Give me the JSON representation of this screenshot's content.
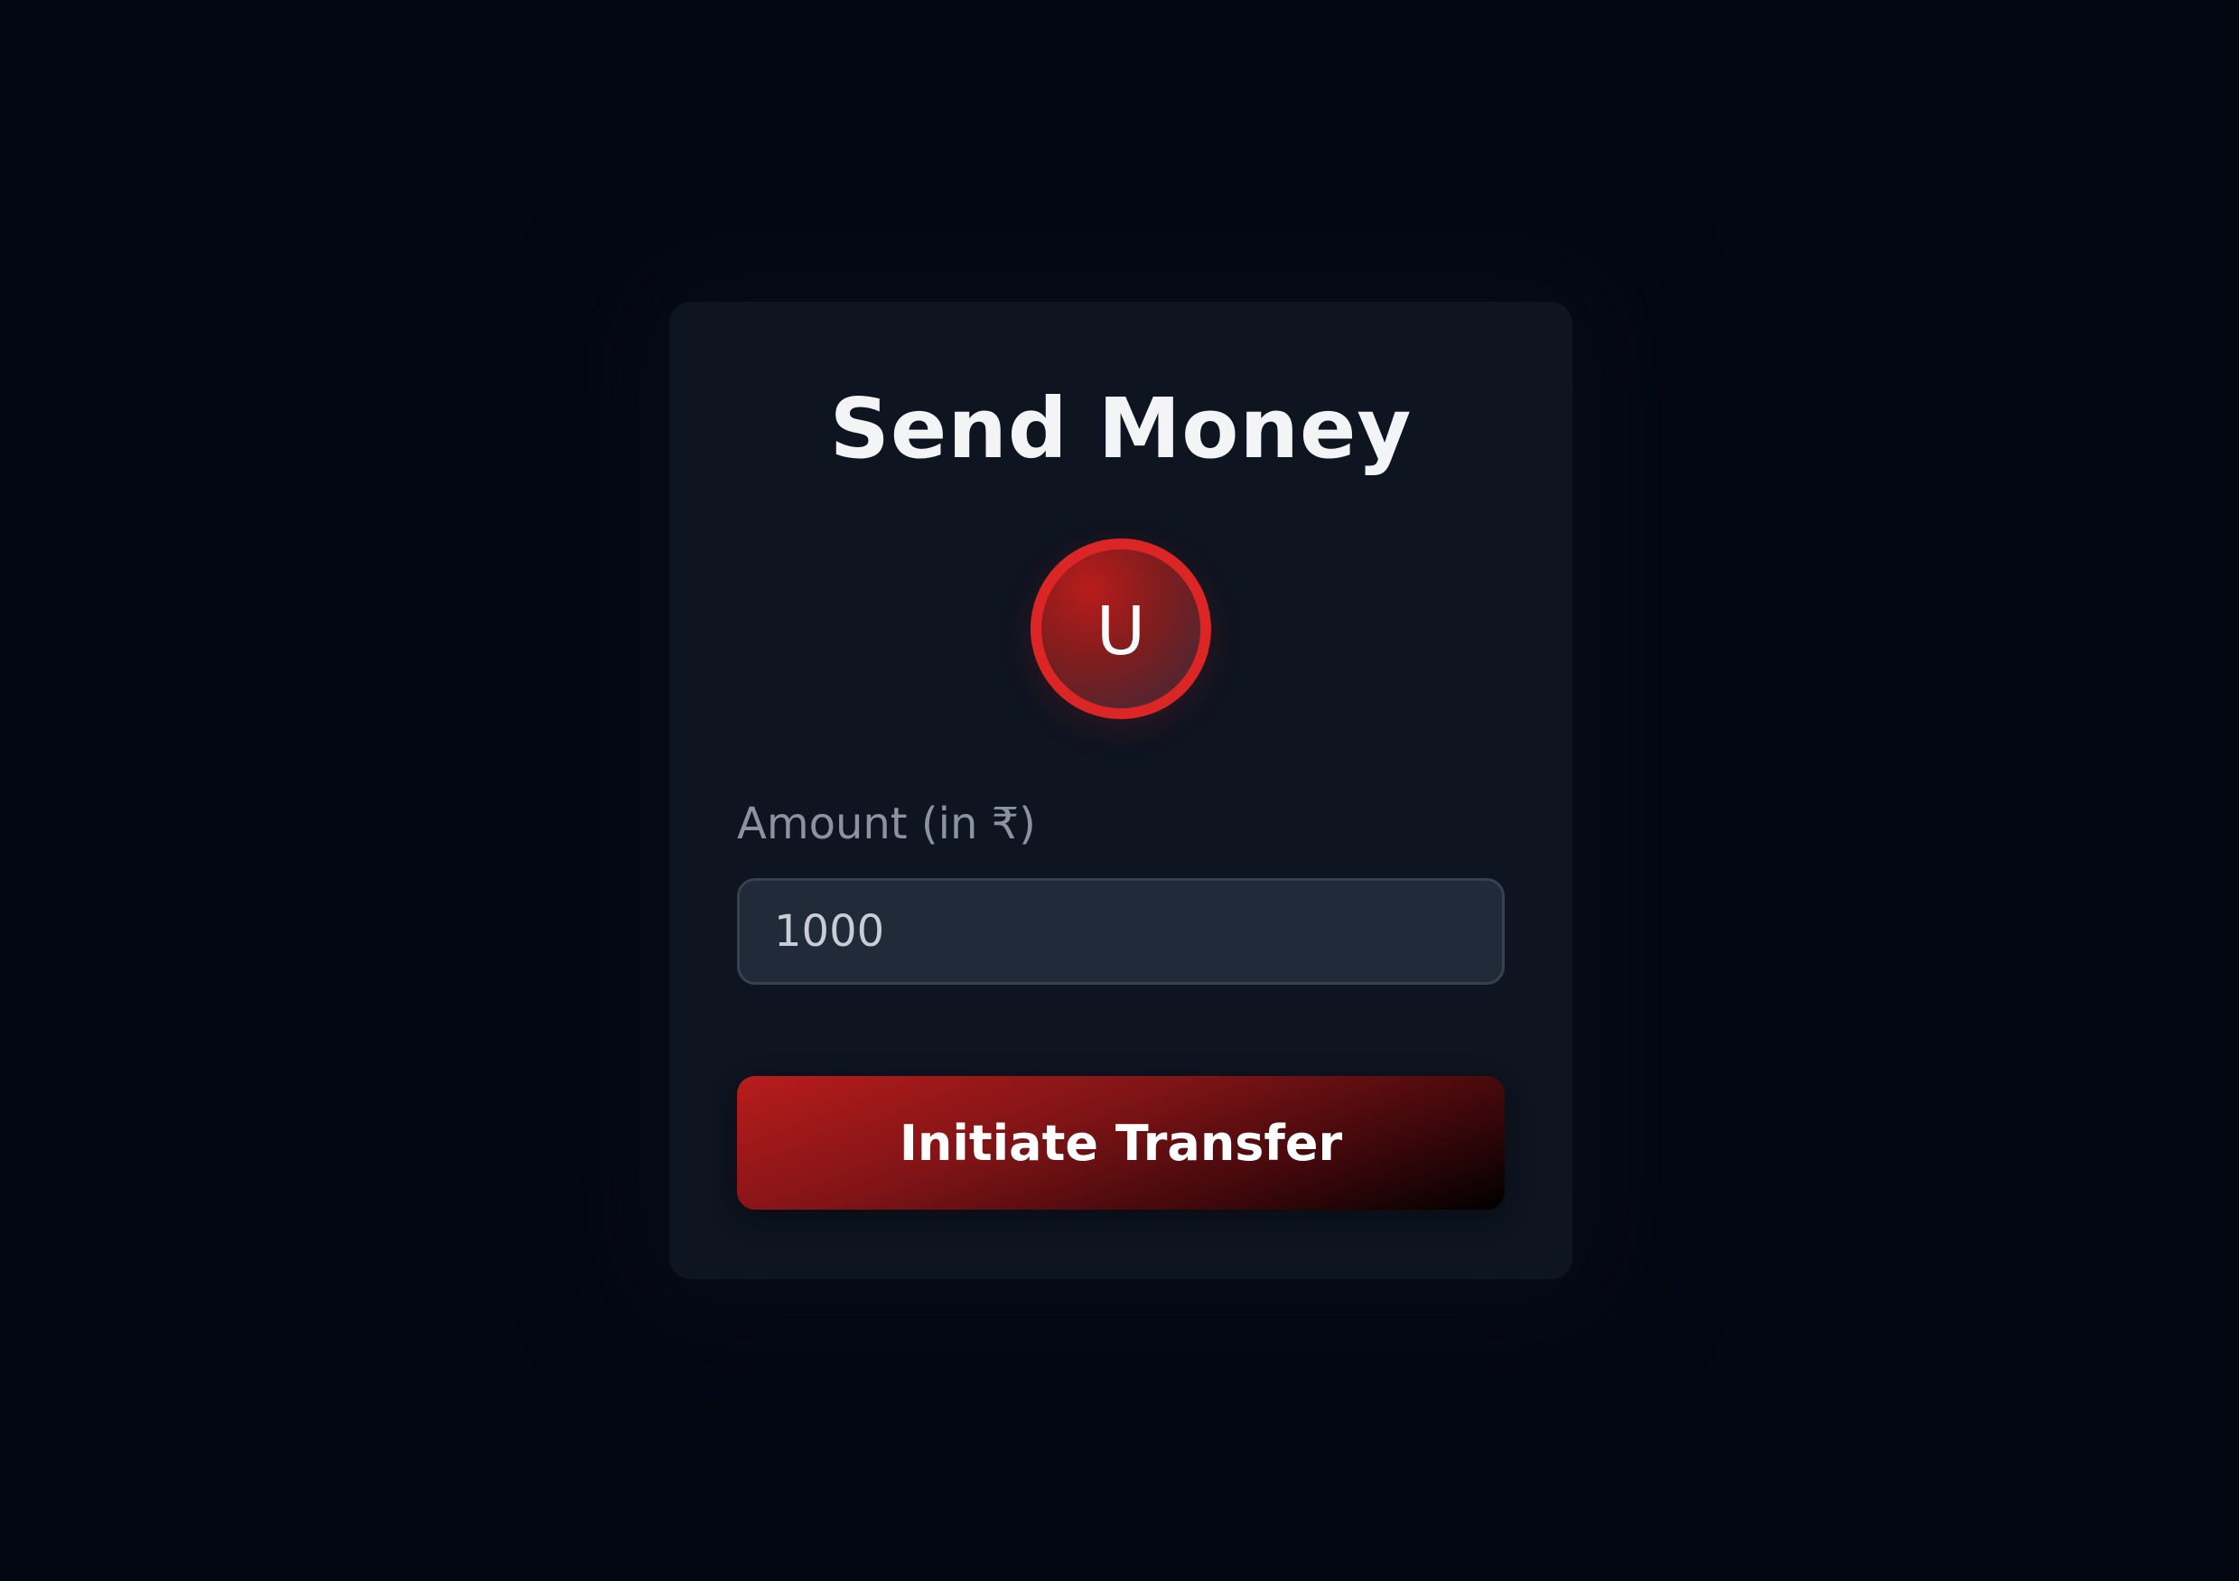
{
  "form": {
    "title": "Send Money",
    "avatar_initial": "U",
    "amount_label": "Amount (in ₹)",
    "amount_value": "1000",
    "submit_label": "Initiate Transfer"
  },
  "colors": {
    "background": "#030712",
    "card": "#0e1420",
    "accent": "#dc2626",
    "input_bg": "#212a38",
    "label": "#8b93a3"
  }
}
